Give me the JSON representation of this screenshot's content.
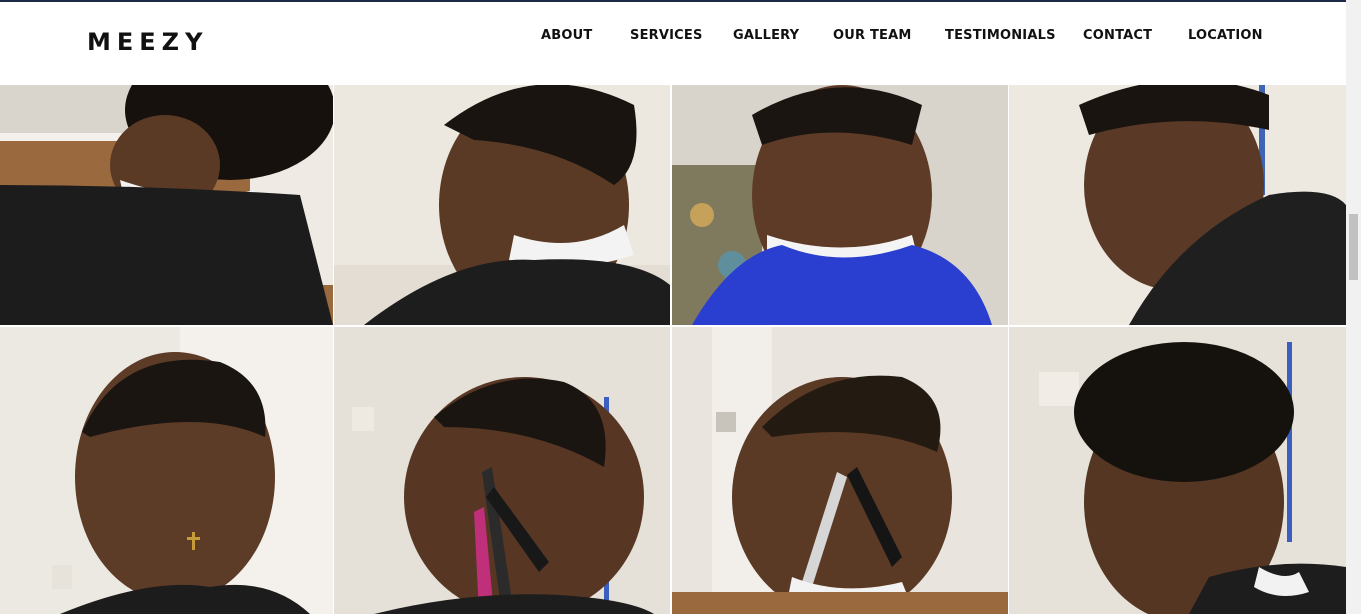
{
  "site": {
    "logo": "MEEZY"
  },
  "nav": {
    "items": [
      {
        "label": "ABOUT"
      },
      {
        "label": "SERVICES"
      },
      {
        "label": "GALLERY"
      },
      {
        "label": "OUR TEAM"
      },
      {
        "label": "TESTIMONIALS"
      },
      {
        "label": "CONTACT"
      },
      {
        "label": "LOCATION"
      }
    ]
  },
  "gallery": {
    "photos": [
      {
        "subject": "back-of-head-taper"
      },
      {
        "subject": "side-profile-fade"
      },
      {
        "subject": "boy-blue-cape-fade"
      },
      {
        "subject": "teen-profile-fade"
      },
      {
        "subject": "front-view-fade-earring"
      },
      {
        "subject": "side-profile-razor-lineup"
      },
      {
        "subject": "profile-razor-lineup-2"
      },
      {
        "subject": "side-profile-curly-top"
      }
    ]
  },
  "colors": {
    "cape": "#1c1c1c",
    "wall": "#e9e4dc",
    "skin": "#5a3a26",
    "hair": "#1a1410",
    "blue_cape": "#2a3ecf",
    "floor": "#9a6a3e"
  }
}
